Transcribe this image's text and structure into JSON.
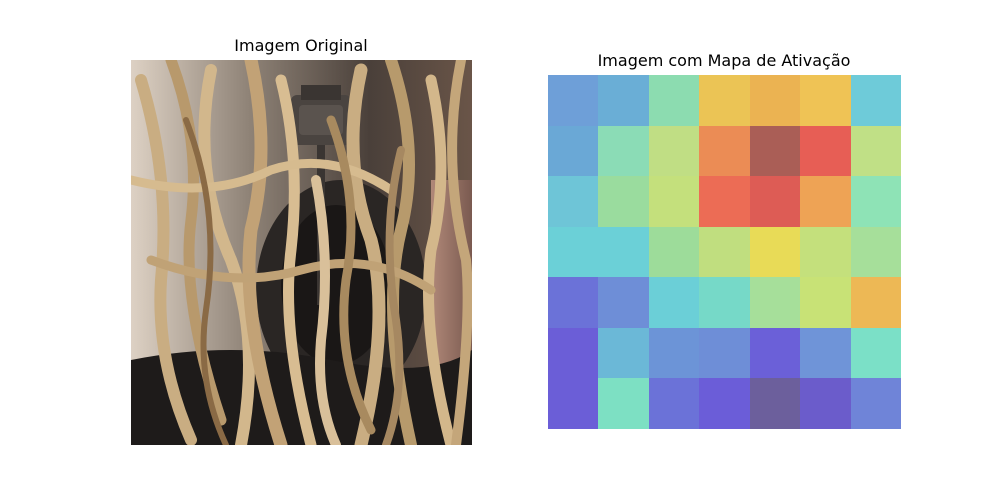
{
  "figure": {
    "left_title": "Imagem Original",
    "right_title": "Imagem com Mapa de Ativação"
  },
  "photo": {
    "subject": "close-up of blond dreadlocks over black over-ear headphones",
    "colors": {
      "background": "#7a6e64",
      "headphone": "#2a2624",
      "hair_light": "#c9ad82",
      "hair_dark": "#8a6a45",
      "shirt": "#1e1b1a"
    }
  },
  "heatmap": {
    "rows": 7,
    "cols": 7,
    "cells": [
      [
        "#6e9fd8",
        "#6aaed6",
        "#8cdcb0",
        "#ebc455",
        "#ebb352",
        "#efc355",
        "#6ecbd9"
      ],
      [
        "#6aa8d6",
        "#8bdcb6",
        "#c0de84",
        "#eb8c55",
        "#aa5e56",
        "#e75e55",
        "#c0e086"
      ],
      [
        "#6ec5d7",
        "#9adc9e",
        "#c4e07c",
        "#ec6c55",
        "#dd5c55",
        "#eea355",
        "#8ee3b6"
      ],
      [
        "#6bd0d7",
        "#6bd0d7",
        "#9ddc9a",
        "#c0de7f",
        "#e8db57",
        "#c4e07c",
        "#a6df9a"
      ],
      [
        "#6b72d8",
        "#6e8ed7",
        "#6bcfd7",
        "#76d9c8",
        "#a6df9a",
        "#c8e276",
        "#edb855"
      ],
      [
        "#6b5ed7",
        "#6bb8d7",
        "#6c94d7",
        "#6e8ed7",
        "#6b60d8",
        "#6f94d8",
        "#7be0c7"
      ],
      [
        "#6b5ed7",
        "#7de0c3",
        "#6b72d8",
        "#6b5dd8",
        "#6c5f9c",
        "#6b5ccb",
        "#6f84d8"
      ]
    ]
  }
}
